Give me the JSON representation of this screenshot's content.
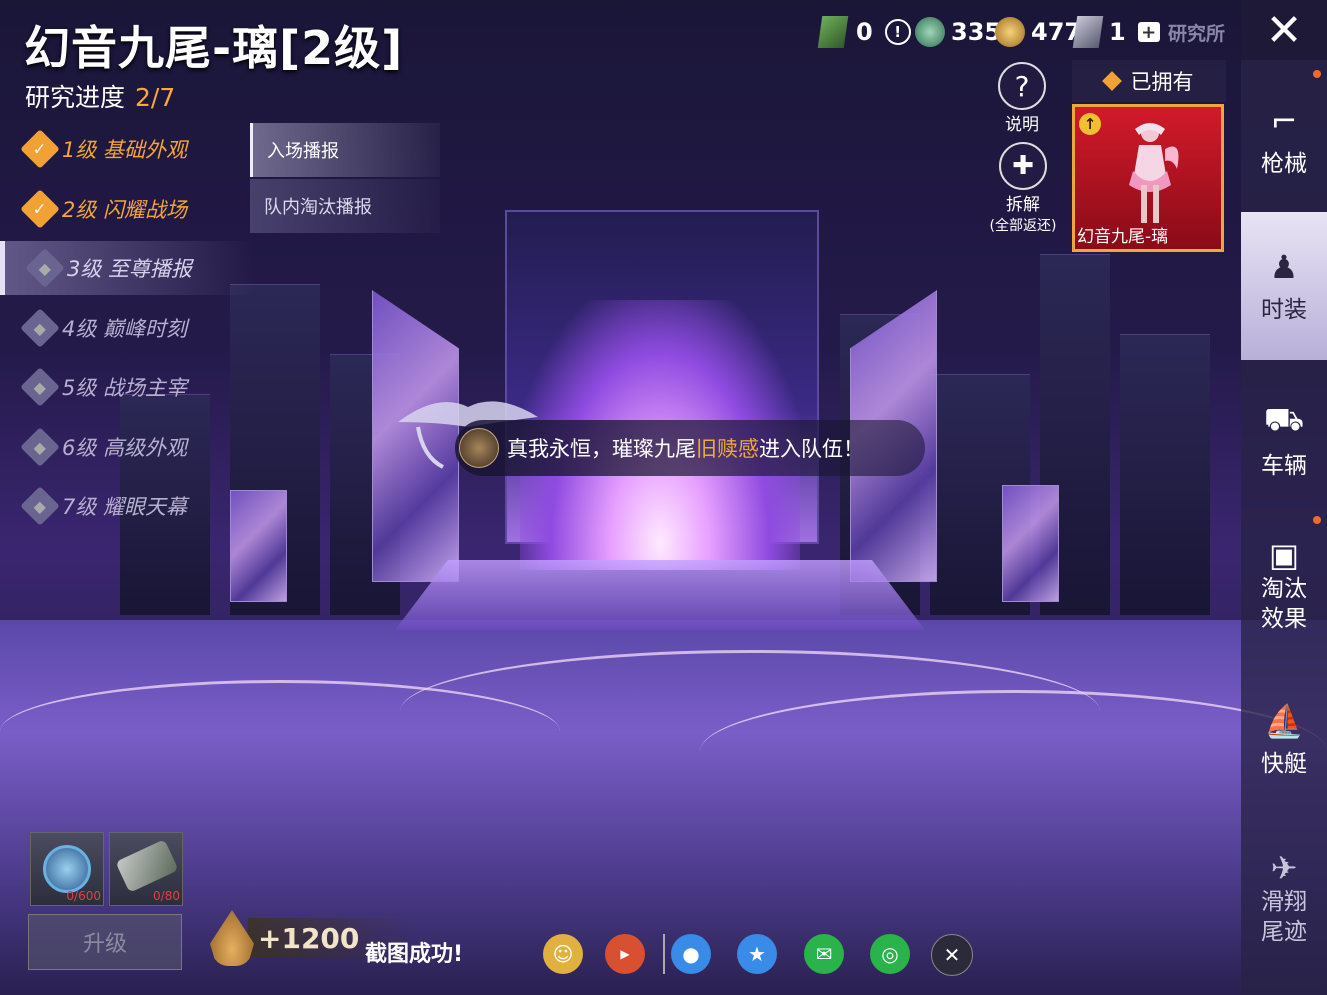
{
  "header": {
    "title": "幻音九尾-璃[2级]",
    "progress_label": "研究进度",
    "progress_value": "2/7"
  },
  "levels": [
    {
      "label": "1级 基础外观",
      "state": "done"
    },
    {
      "label": "2级 闪耀战场",
      "state": "done"
    },
    {
      "label": "3级 至尊播报",
      "state": "active"
    },
    {
      "label": "4级 巅峰时刻",
      "state": "locked"
    },
    {
      "label": "5级 战场主宰",
      "state": "locked"
    },
    {
      "label": "6级 高级外观",
      "state": "locked"
    },
    {
      "label": "7级 耀眼天幕",
      "state": "locked"
    }
  ],
  "subtabs": [
    {
      "label": "入场播报",
      "selected": true
    },
    {
      "label": "队内淘汰播报",
      "selected": false
    }
  ],
  "currencies": {
    "ticket": "0",
    "coin_a": "335",
    "coin_b": "477",
    "card": "1",
    "lab_label": "研究所"
  },
  "help": {
    "label": "说明",
    "icon": "question-icon"
  },
  "dismantle": {
    "label": "拆解",
    "sub": "(全部返还)",
    "icon": "puzzle-icon"
  },
  "owned": {
    "header": "已拥有",
    "item_name": "幻音九尾-璃"
  },
  "sidebar": [
    {
      "label": "枪械",
      "icon": "gun-icon",
      "selected": false,
      "badge": true
    },
    {
      "label": "时装",
      "icon": "outfit-icon",
      "selected": true,
      "badge": false
    },
    {
      "label": "车辆",
      "icon": "vehicle-icon",
      "selected": false,
      "badge": false
    },
    {
      "label": "淘汰\n效果",
      "icon": "crate-icon",
      "selected": false,
      "badge": true
    },
    {
      "label": "快艇",
      "icon": "boat-icon",
      "selected": false,
      "badge": false
    },
    {
      "label": "滑翔\n尾迹",
      "icon": "glider-icon",
      "selected": false,
      "badge": false
    }
  ],
  "banner": {
    "prefix": "真我永恒，璀璨九尾",
    "player": "旧赎感",
    "suffix": "进入队伍！"
  },
  "items": [
    {
      "count": "0/600"
    },
    {
      "count": "0/80"
    }
  ],
  "upgrade_label": "升级",
  "exp_gain": "+1200",
  "screenshot_msg": "截图成功!",
  "colors": {
    "accent": "#f2a235",
    "card_bg": "#d21a2a",
    "highlight": "#f1a83a"
  }
}
